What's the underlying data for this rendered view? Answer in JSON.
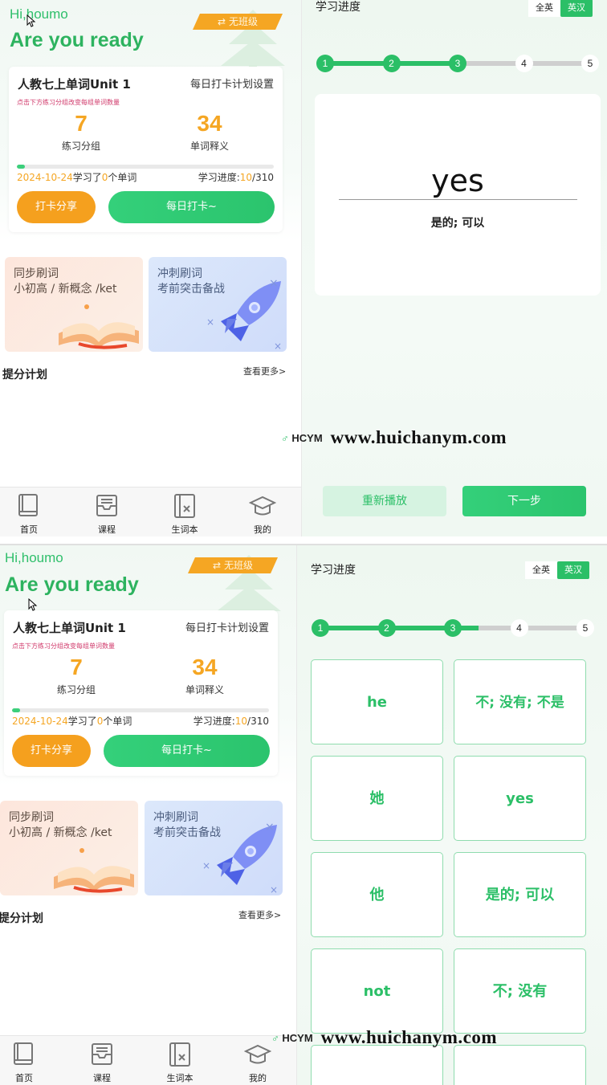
{
  "screen1": {
    "left": {
      "greeting": "Hi,houmo",
      "headline": "Are you ready",
      "class_tag": "无班级",
      "class_tag_icon": "swap-icon",
      "book_title": "人教七上单词Unit 1",
      "daily_setting_link": "每日打卡计划设置",
      "hint": "点击下方练习分组改变每组单词数量",
      "stats": [
        {
          "value": "7",
          "label": "练习分组"
        },
        {
          "value": "34",
          "label": "单词释义"
        }
      ],
      "date": "2024-10-24",
      "learned_prefix": "学习了",
      "learned_count": "0",
      "learned_suffix": "个单词",
      "progress_label": "学习进度:",
      "progress_done": "10",
      "progress_total": "/310",
      "progress_fraction": 0.032,
      "share_button": "打卡分享",
      "checkin_button": "每日打卡~",
      "promo1": {
        "line1": "同步刷词",
        "line2": "小初高 / 新概念 /ket"
      },
      "promo2": {
        "line1": "冲刺刷词",
        "line2": "考前突击备战"
      },
      "plan_title": "提分计划",
      "see_more": "查看更多>",
      "tabs": [
        {
          "label": "首页",
          "icon": "book-icon"
        },
        {
          "label": "课程",
          "icon": "inbox-icon"
        },
        {
          "label": "生词本",
          "icon": "wordbook-icon"
        },
        {
          "label": "我的",
          "icon": "graduation-cap-icon"
        }
      ]
    },
    "right": {
      "title": "学习进度",
      "lang_all_english": "全英",
      "lang_english_chinese": "英汉",
      "steps": [
        "1",
        "2",
        "3",
        "4",
        "5"
      ],
      "completed_steps": 3,
      "word": "yes",
      "meaning": "是的; 可以",
      "replay_button": "重新播放",
      "next_button": "下一步"
    },
    "watermark": {
      "logo": "HCYM",
      "url": "www.huichanym.com"
    }
  },
  "screen2": {
    "left": {
      "greeting": "Hi,houmo",
      "headline": "Are you ready",
      "class_tag": "无班级",
      "book_title": "人教七上单词Unit 1",
      "daily_setting_link": "每日打卡计划设置",
      "hint": "点击下方练习分组改变每组单词数量",
      "stats": [
        {
          "value": "7",
          "label": "练习分组"
        },
        {
          "value": "34",
          "label": "单词释义"
        }
      ],
      "date": "2024-10-24",
      "learned_prefix": "学习了",
      "learned_count": "0",
      "learned_suffix": "个单词",
      "progress_label": "学习进度:",
      "progress_done": "10",
      "progress_total": "/310",
      "progress_fraction": 0.032,
      "share_button": "打卡分享",
      "checkin_button": "每日打卡~",
      "promo1": {
        "line1": "同步刷词",
        "line2": "小初高 / 新概念 /ket"
      },
      "promo2": {
        "line1": "冲刺刷词",
        "line2": "考前突击备战"
      },
      "plan_title": "提分计划",
      "see_more": "查看更多>",
      "tabs": [
        {
          "label": "首页",
          "icon": "book-icon"
        },
        {
          "label": "课程",
          "icon": "inbox-icon"
        },
        {
          "label": "生词本",
          "icon": "wordbook-icon"
        },
        {
          "label": "我的",
          "icon": "graduation-cap-icon"
        }
      ]
    },
    "right": {
      "title": "学习进度",
      "lang_all_english": "全英",
      "lang_english_chinese": "英汉",
      "steps": [
        "1",
        "2",
        "3",
        "4",
        "5"
      ],
      "completed_steps": 3,
      "step_progress_fraction": 0.6,
      "tiles": [
        "he",
        "不; 没有; 不是",
        "她",
        "yes",
        "他",
        "是的; 可以",
        "not",
        "不; 没有"
      ]
    },
    "watermark": {
      "logo": "HCYM",
      "url": "www.huichanym.com"
    }
  },
  "colors": {
    "accent": "#2bbf67",
    "orange": "#f5a623",
    "hint": "#d0386a"
  }
}
